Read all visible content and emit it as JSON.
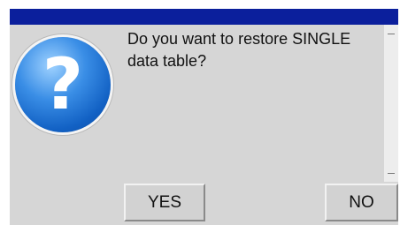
{
  "dialog": {
    "message": "Do you want to restore SINGLE\ndata table?",
    "icon": "question-icon",
    "buttons": {
      "yes_label": "YES",
      "no_label": "NO"
    },
    "colors": {
      "title_bar": "#0b1f9c",
      "background": "#d6d6d6",
      "icon_blue": "#1261c4"
    }
  }
}
